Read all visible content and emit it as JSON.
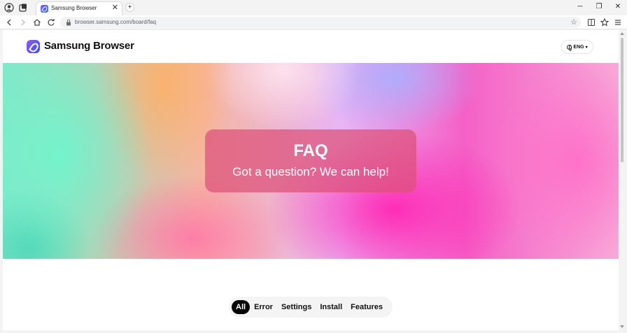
{
  "browser": {
    "tab": {
      "title": "Samsung Browser",
      "close": "✕"
    },
    "new_tab": "+",
    "window": {
      "minimize": "─",
      "restore": "❐",
      "close": "✕"
    },
    "address": {
      "url": "browser.samsung.com/board/faq"
    }
  },
  "site": {
    "logo_text": "Samsung Browser",
    "language": {
      "label": "ENG",
      "caret": "▾"
    }
  },
  "hero": {
    "title": "FAQ",
    "subtitle": "Got a question? We can help!"
  },
  "filters": {
    "items": [
      "All",
      "Error",
      "Settings",
      "Install",
      "Features"
    ],
    "selected": "All"
  },
  "colors": {
    "filter_active_bg": "#000000",
    "logo_gradient_start": "#8a5cff",
    "logo_gradient_end": "#3a4cff"
  },
  "icons": {
    "profile": "person-circle-icon",
    "tabs": "tab-actions-icon",
    "back": "arrow-left-icon",
    "forward": "arrow-right-icon",
    "home": "home-icon",
    "reload": "reload-icon",
    "lock": "lock-icon",
    "favorite": "star-icon",
    "split": "split-screen-icon",
    "favorites": "favorites-star-icon",
    "menu": "hamburger-menu-icon",
    "globe": "globe-icon"
  }
}
